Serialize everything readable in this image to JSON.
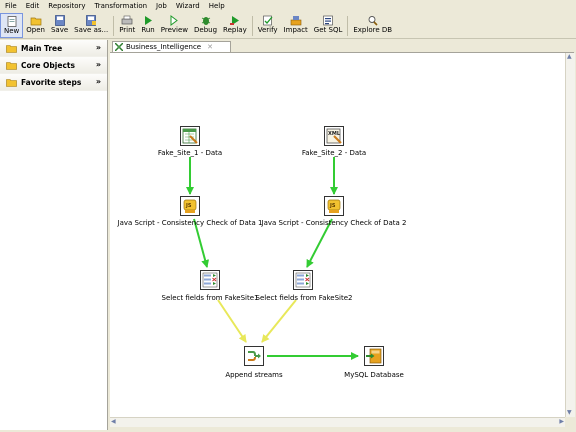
{
  "menu": [
    "File",
    "Edit",
    "Repository",
    "Transformation",
    "Job",
    "Wizard",
    "Help"
  ],
  "toolbar": {
    "new": "New",
    "open": "Open",
    "save": "Save",
    "save_as": "Save as...",
    "print": "Print",
    "run": "Run",
    "preview": "Preview",
    "debug": "Debug",
    "replay": "Replay",
    "verify": "Verify",
    "impact": "Impact",
    "get_sql": "Get SQL",
    "explore_db": "Explore DB"
  },
  "sidebar": {
    "items": [
      {
        "label": "Main Tree",
        "chevron": "»"
      },
      {
        "label": "Core Objects",
        "chevron": "»"
      },
      {
        "label": "Favorite steps",
        "chevron": "»"
      }
    ]
  },
  "tab": {
    "title": "Business_Intelligence",
    "close": "✕"
  },
  "steps": [
    {
      "id": "fake1",
      "label": "Fake_Site_1 - Data",
      "icon": "excel-input-icon"
    },
    {
      "id": "fake2",
      "label": "Fake_Site_2 - Data",
      "icon": "xml-input-icon"
    },
    {
      "id": "js1",
      "label": "Java Script - Consistency Check of Data 1",
      "icon": "javascript-icon"
    },
    {
      "id": "js2",
      "label": "Java Script - Consistency Check of Data 2",
      "icon": "javascript-icon"
    },
    {
      "id": "sel1",
      "label": "Select fields from FakeSite1",
      "icon": "select-values-icon"
    },
    {
      "id": "sel2",
      "label": "Select fields from FakeSite2",
      "icon": "select-values-icon"
    },
    {
      "id": "append",
      "label": "Append streams",
      "icon": "append-icon"
    },
    {
      "id": "mysql",
      "label": "MySQL Database",
      "icon": "table-output-icon"
    }
  ],
  "colors": {
    "hop_normal": "#33cc33",
    "hop_copy": "#e8e85a"
  }
}
